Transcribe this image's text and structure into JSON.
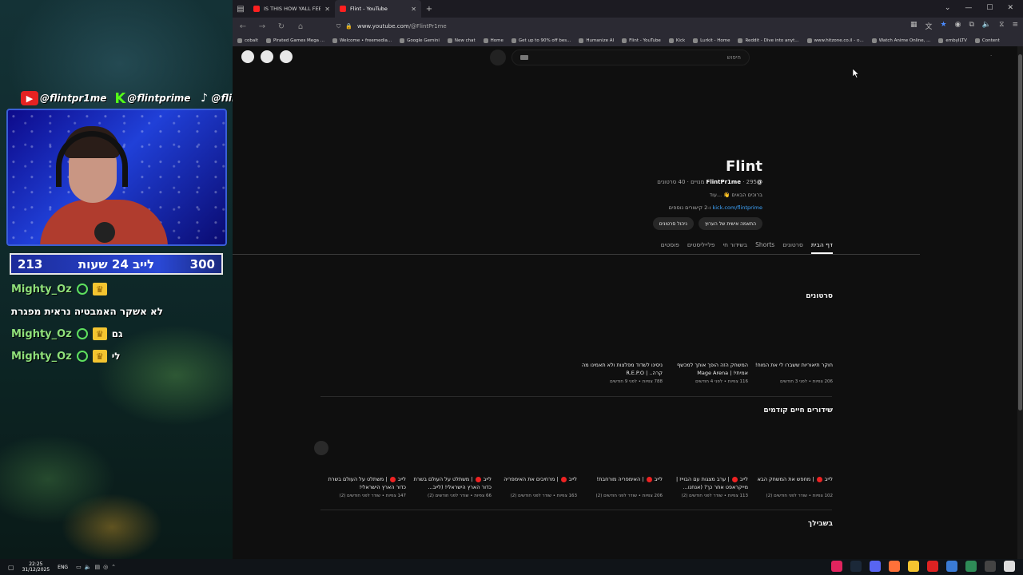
{
  "overlay": {
    "socials": [
      {
        "icon": "youtube-icon",
        "handle": "@flintpr1me"
      },
      {
        "icon": "kick-icon",
        "handle": "@flintprime"
      },
      {
        "icon": "tiktok-icon",
        "handle": "@flintprime"
      }
    ],
    "counter": {
      "left": "213",
      "middle": "לייב 24 שעות",
      "right": "300"
    },
    "chat": [
      {
        "user": "Mighty_Oz",
        "text": ""
      },
      {
        "user": "",
        "text": "לא אשקר האמבטיה נראית מפגרת"
      },
      {
        "user": "Mighty_Oz",
        "text": "גם"
      },
      {
        "user": "Mighty_Oz",
        "text": "לי"
      }
    ]
  },
  "browser": {
    "tabs": [
      {
        "title": "IS THIS HOW YALL FEEL? - YouT",
        "active": false
      },
      {
        "title": "Flint - YouTube",
        "active": true
      }
    ],
    "url": {
      "host": "www.youtube.com",
      "path": "/@FlintPr1me"
    },
    "bookmarks": [
      "cobalt",
      "Pirated Games Mega ...",
      "Welcome • freemedia...",
      "Google Gemini",
      "New chat",
      "Home",
      "Get up to 90% off bes...",
      "Humanize AI",
      "Flint - YouTube",
      "Kick",
      "Lurkit - Home",
      "Reddit - Dive into anyt...",
      "www.hitzone.co.il - ט...",
      "Watch Anime Online, ...",
      "embyILTV",
      "Content"
    ]
  },
  "youtube": {
    "search_placeholder": "חיפוש",
    "channel": {
      "name": "Flint",
      "handle": "@FlintPr1me",
      "meta": "· 295 מנויים · 40 סרטונים",
      "description": "ברוכים הבאים 👋 ...עוד",
      "link": "kick.com/flintprime",
      "link_suffix": "ו-2 קישורים נוספים"
    },
    "buttons": {
      "customize": "התאמה אישית של הערוץ",
      "manage": "ניהול סרטונים"
    },
    "tabs": [
      "דף הבית",
      "סרטונים",
      "Shorts",
      "בשידור חי",
      "פלייליסטים",
      "פוסטים"
    ],
    "sections": {
      "videos_title": "סרטונים",
      "videos": [
        {
          "title": "חוקר תיאוריות ששברו לי את המוח!",
          "meta": "206 צפיות • לפני 3 חודשים"
        },
        {
          "title": "המשחק הזה הופך אותך למכשף אמיתי! | Mage Arena",
          "meta": "116 צפיות • לפני 4 חודשים"
        },
        {
          "title": "ניסינו לשדוד מפלצות ולא תאמינו מה קרה.. | R.E.P.O",
          "meta": "788 צפיות • לפני 9 חודשים"
        }
      ],
      "live_title": "שידורים חיים קודמים",
      "live": [
        {
          "prefix": "לייב",
          "title": "| מחפש את המשחק הבא",
          "meta": "102 צפיות • שודר לפני חודשים (2)"
        },
        {
          "prefix": "לייב",
          "title": "| ערב מצגות עם הבוייז | מייקראפט אחר כך? (אנחנו...",
          "meta": "113 צפיות • שודר לפני חודשים (2)"
        },
        {
          "prefix": "לייב",
          "title": "| האימפריה מורחבת!",
          "meta": "206 צפיות • שודר לפני חודשים (2)"
        },
        {
          "prefix": "לייב",
          "title": "| מרחיבים את האימפריה",
          "meta": "163 צפיות • שודר לפני חודשים (2)"
        },
        {
          "prefix": "לייב",
          "title": "| משתלט על העולם בשרת כדור הארץ הישראלי! (לייב...",
          "meta": "66 צפיות • שודר לפני חודשים (2)"
        },
        {
          "prefix": "לייב",
          "title": "| משתלט על העולם בשרת כדור הארץ הישראלי!",
          "meta": "147 צפיות • שודר לפני חודשים (2)"
        }
      ],
      "for_you_title": "בשבילך"
    }
  },
  "taskbar": {
    "time": "22:25",
    "date": "31/12/2025",
    "lang": "ENG"
  }
}
